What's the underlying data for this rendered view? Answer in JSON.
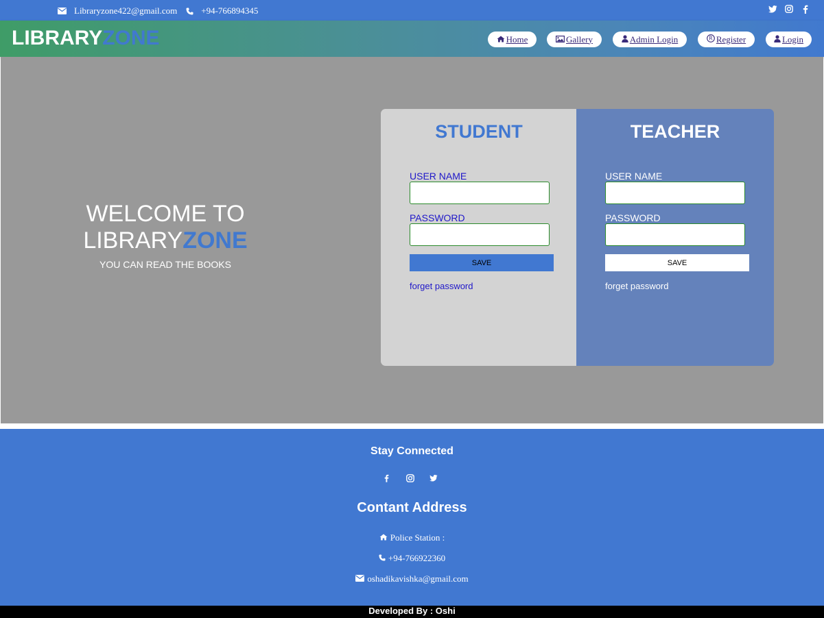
{
  "topbar": {
    "email": "Libraryzone422@gmail.com",
    "phone": "+94-766894345",
    "social_icons": [
      "twitter-icon",
      "instagram-icon",
      "facebook-icon"
    ]
  },
  "header": {
    "logo_part1": "LIBRARY",
    "logo_part2": "ZONE",
    "nav": [
      {
        "label": "Home",
        "icon": "home-icon"
      },
      {
        "label": "Gallery",
        "icon": "image-icon"
      },
      {
        "label": "Admin Login",
        "icon": "user-icon"
      },
      {
        "label": "Register",
        "icon": "registered-icon"
      },
      {
        "label": "Login",
        "icon": "user-icon"
      }
    ]
  },
  "hero": {
    "line1": "WELCOME TO",
    "line2_part1": "LIBRARY",
    "line2_part2": "ZONE",
    "subtitle": "YOU CAN READ THE BOOKS"
  },
  "student": {
    "title": "STUDENT",
    "username_label": "USER NAME",
    "password_label": "PASSWORD",
    "username_value": "",
    "password_value": "",
    "save_label": "SAVE",
    "forget_label": "forget password"
  },
  "teacher": {
    "title": "TEACHER",
    "username_label": "USER NAME",
    "password_label": "PASSWORD",
    "username_value": "",
    "password_value": "",
    "save_label": "SAVE",
    "forget_label": "forget password"
  },
  "footer": {
    "stay_connected": "Stay Connected",
    "social_icons": [
      "facebook-icon",
      "instagram-icon",
      "twitter-icon"
    ],
    "address_title": "Contant Address",
    "address": "Police Station :",
    "phone": "+94-766922360",
    "email": "oshadikavishka@gmail.com",
    "developed_by": "Developed By : Oshi"
  },
  "colors": {
    "primary_blue": "#4178d1",
    "main_gray": "#999999",
    "student_panel": "#d3d3d3",
    "teacher_panel": "#6482bb",
    "label_blue": "#1f17c9"
  }
}
